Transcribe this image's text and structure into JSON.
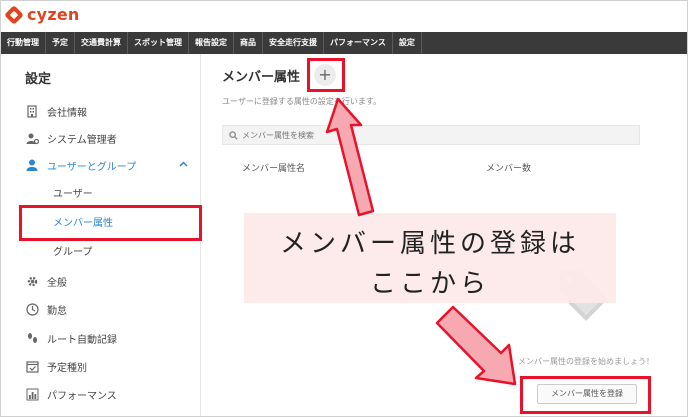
{
  "brand": {
    "logo_text": "cyzen",
    "accent": "#e0451f"
  },
  "topnav": {
    "items": [
      "行動管理",
      "予定",
      "交通費計算",
      "スポット管理",
      "報告設定",
      "商品",
      "安全走行支援",
      "パフォーマンス",
      "設定"
    ]
  },
  "sidebar": {
    "title": "設定",
    "items": [
      {
        "label": "会社情報",
        "icon": "building-icon"
      },
      {
        "label": "システム管理者",
        "icon": "admin-user-icon"
      },
      {
        "label": "ユーザーとグループ",
        "icon": "user-icon",
        "expanded": true
      },
      {
        "label": "全般",
        "icon": "gear-icon"
      },
      {
        "label": "勤怠",
        "icon": "clock-icon"
      },
      {
        "label": "ルート自動記録",
        "icon": "footprints-icon"
      },
      {
        "label": "予定種別",
        "icon": "calendar-check-icon"
      },
      {
        "label": "パフォーマンス",
        "icon": "bar-chart-icon"
      }
    ],
    "subitems": [
      "ユーザー",
      "メンバー属性",
      "グループ"
    ],
    "active_color": "#2a86d1"
  },
  "main": {
    "title": "メンバー属性",
    "add_symbol": "+",
    "description": "ユーザーに登録する属性の設定を行います。",
    "search_placeholder": "メンバー属性を検索",
    "columns": [
      "メンバー属性名",
      "メンバー数"
    ],
    "empty_message": "メンバー属性の登録を始めましょう！",
    "register_button": "メンバー属性を登録"
  },
  "annotation": {
    "line1": "メンバー属性の登録は",
    "line2": "ここから",
    "highlight_color": "#e8132a"
  }
}
